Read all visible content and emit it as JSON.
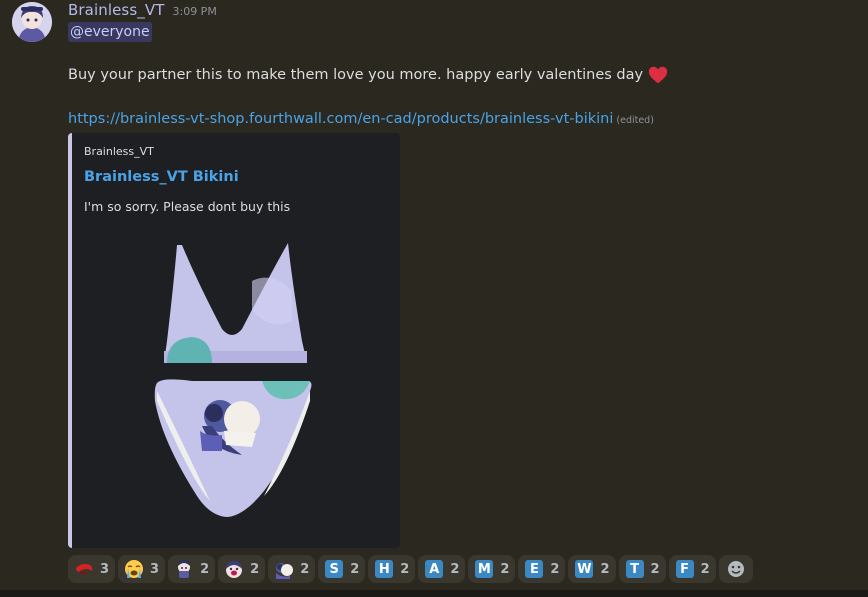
{
  "message": {
    "username": "Brainless_VT",
    "timestamp": "3:09 PM",
    "mention": "@everyone",
    "body": "Buy your partner this to make them love you more. happy early valentines day",
    "heart_icon": "red-heart-icon",
    "link": "https://brainless-vt-shop.fourthwall.com/en-cad/products/brainless-vt-bikini",
    "edited_label": "(edited)"
  },
  "embed": {
    "provider": "Brainless_VT",
    "title": "Brainless_VT Bikini",
    "description": "I'm so sorry. Please dont buy this",
    "accent_color": "#c9c6e6",
    "image": "bikini-product-image"
  },
  "reactions": [
    {
      "icon": "tongue-red-emoji",
      "count": "3"
    },
    {
      "icon": "loudly-crying-face-emoji",
      "count": "3"
    },
    {
      "icon": "custom-character-emoji-1",
      "count": "2"
    },
    {
      "icon": "custom-character-emoji-2",
      "count": "2"
    },
    {
      "icon": "custom-character-emoji-3",
      "count": "2"
    },
    {
      "icon": "regional-indicator-s",
      "letter": "S",
      "count": "2"
    },
    {
      "icon": "regional-indicator-h",
      "letter": "H",
      "count": "2"
    },
    {
      "icon": "regional-indicator-a",
      "letter": "A",
      "count": "2"
    },
    {
      "icon": "regional-indicator-m",
      "letter": "M",
      "count": "2"
    },
    {
      "icon": "regional-indicator-e",
      "letter": "E",
      "count": "2"
    },
    {
      "icon": "regional-indicator-w",
      "letter": "W",
      "count": "2"
    },
    {
      "icon": "regional-indicator-t",
      "letter": "T",
      "count": "2"
    },
    {
      "icon": "regional-indicator-f",
      "letter": "F",
      "count": "2"
    }
  ],
  "add_reaction_icon": "add-reaction-smiley-icon",
  "colors": {
    "background": "#2b2820",
    "link": "#4aa3e6",
    "username": "#b5b9e8",
    "embed_background": "#1e1f22",
    "reaction_background": "#3a372e",
    "regional_indicator": "#3b88c3"
  }
}
